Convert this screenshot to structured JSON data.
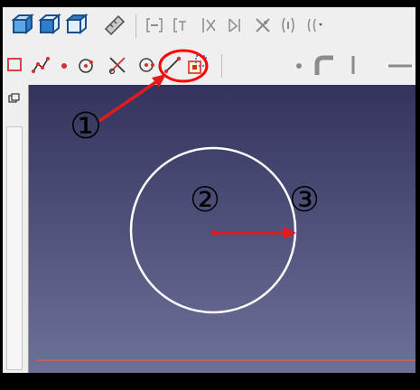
{
  "annotations": {
    "step1": "①",
    "step2": "②",
    "step3": "③"
  },
  "colors": {
    "viewport_top": "#33335c",
    "viewport_bottom": "#6d7198",
    "circle": "#ffffff",
    "highlight": "#ff0000",
    "arrow": "#e11b1b",
    "x_axis": "#d25a5a"
  },
  "toolbar": {
    "row1_icons": [
      "view-iso-icon",
      "view-front-icon",
      "view-top-icon",
      "measure-icon",
      "constraint-coincident-icon",
      "constraint-point-on-object-icon",
      "constraint-vertical-distance-icon",
      "constraint-horizontal-distance-icon",
      "constraint-lock-icon",
      "constraint-block-icon",
      "constraint-more-icon"
    ],
    "row2_icons": [
      "rectangle-icon",
      "polyline-icon",
      "point-icon",
      "arc-icon",
      "trim-icon",
      "circle-icon",
      "line-icon",
      "external-geometry-icon",
      "point-tool-icon",
      "fillet-icon",
      "vertical-line-icon",
      "horizontal-line-icon"
    ],
    "highlighted_tool": "circle-icon"
  }
}
